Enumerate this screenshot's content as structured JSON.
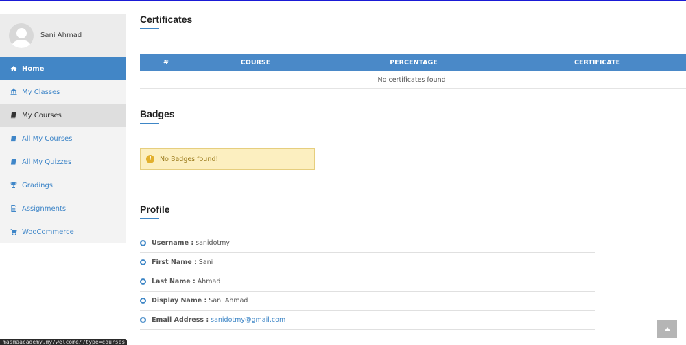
{
  "user": {
    "name": "Sani Ahmad"
  },
  "sidebar": {
    "items": [
      {
        "label": "Home",
        "icon": "home-icon",
        "state": "active"
      },
      {
        "label": "My Classes",
        "icon": "bank-icon",
        "state": "normal"
      },
      {
        "label": "My Courses",
        "icon": "book-icon",
        "state": "selected"
      },
      {
        "label": "All My Courses",
        "icon": "book-icon",
        "state": "normal"
      },
      {
        "label": "All My Quizzes",
        "icon": "book-icon",
        "state": "normal"
      },
      {
        "label": "Gradings",
        "icon": "trophy-icon",
        "state": "normal"
      },
      {
        "label": "Assignments",
        "icon": "document-icon",
        "state": "normal"
      },
      {
        "label": "WooCommerce",
        "icon": "cart-icon",
        "state": "normal"
      }
    ]
  },
  "certificates": {
    "title": "Certificates",
    "columns": [
      "#",
      "COURSE",
      "PERCENTAGE",
      "CERTIFICATE"
    ],
    "empty_message": "No certificates found!"
  },
  "badges": {
    "title": "Badges",
    "alert": "No Badges found!"
  },
  "profile": {
    "title": "Profile",
    "fields": [
      {
        "label": "Username :",
        "value": "sanidotmy"
      },
      {
        "label": "First Name :",
        "value": "Sani"
      },
      {
        "label": "Last Name :",
        "value": "Ahmad"
      },
      {
        "label": "Display Name :",
        "value": "Sani Ahmad"
      },
      {
        "label": "Email Address :",
        "value": "sanidotmy@gmail.com"
      }
    ]
  },
  "status_bar": {
    "url": "masmaacademy.my/welcome/?type=courses"
  },
  "colors": {
    "accent": "#4286c6",
    "alert_bg": "#fcefc0",
    "alert_text": "#9b7b1d"
  }
}
